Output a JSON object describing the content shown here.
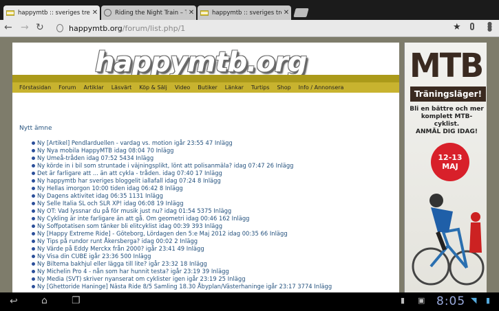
{
  "tabs": [
    {
      "title": "happymtb :: sveriges trevlig"
    },
    {
      "title": "Riding the Night Train – Tips"
    },
    {
      "title": "happymtb :: sveriges trevlig"
    }
  ],
  "address": {
    "host": "happymtb.org",
    "path": "/forum/list.php/1"
  },
  "site": {
    "logo": "happymtb.org",
    "nav": [
      "Förstasidan",
      "Forum",
      "Artiklar",
      "Läsvärt",
      "Köp & Sälj",
      "Video",
      "Butiker",
      "Länkar",
      "Turtips",
      "Shop",
      "Info / Annonsera"
    ],
    "nytt_label": "Nytt ämne"
  },
  "posts": [
    "Ny [Artikel] Pendlarduellen - vardag vs. motion igår 23:55 47 Inlägg",
    "Ny Nya mobila HappyMTB idag 08:04 70 Inlägg",
    "Ny Umeå-tråden idag 07:52 5434 Inlägg",
    "Ny körde in i bil som struntade i väjningsplikt, lönt att polisanmäla? idag 07:47 26 Inlägg",
    "Det är farligare att ... än att cykla - tråden. idag 07:40 17 Inlägg",
    "Ny happymtb har sveriges bloggelit iallafall idag 07:24 8 Inlägg",
    "Ny Hellas imorgon 10:00 tiden idag 06:42 8 Inlägg",
    "Ny Dagens aktivitet idag 06:35 1131 Inlägg",
    "Ny Selle Italia SL och SLR XP! idag 06:08 19 Inlägg",
    "Ny OT: Vad lyssnar du på för musik just nu? idag 01:54 5375 Inlägg",
    "Ny Cykling är inte farligare än att gå. Om geometri idag 00:46 162 Inlägg",
    "Ny Soffpotatisen som tänker bli elitcyklist idag 00:39 393 Inlägg",
    "Ny [Happy Extreme Ride] - Göteborg, Lördagen den 5:e Maj 2012 idag 00:35 66 Inlägg",
    "Ny Tips på rundor runt Åkersberga? idag 00:02 2 Inlägg",
    "Ny Värde på Eddy Merckx från 2000? igår 23:41 49 Inlägg",
    "Ny Visa din CUBE igår 23:36 500 Inlägg",
    "Ny Biltema bakhjul eller lägga till lite? igår 23:32 18 Inlägg",
    "Ny Michelin Pro 4 - nån som har hunnit testa? igår 23:19 39 Inlägg",
    "Ny Media (SVT) skriver nyanserat om cyklister igen igår 23:19 25 Inlägg",
    "Ny [Ghettoride Haninge] Nästa Ride 8/5 Samling 18.30 Åbyplan/Västerhaninge igår 23:17 3774 Inlägg"
  ],
  "ad": {
    "title": "MTB",
    "subtitle": "Träningsläger!",
    "body": "Bli en bättre och mer komplett MTB-cyklist.",
    "cta": "ANMÄL DIG IDAG!",
    "date": "12-13 MAJ"
  },
  "status": {
    "clock": "8:05"
  }
}
